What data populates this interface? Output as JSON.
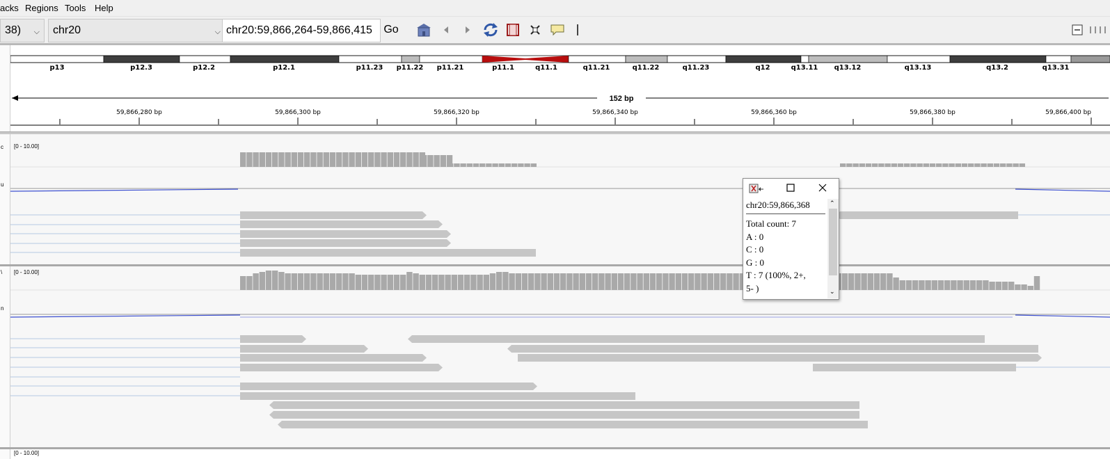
{
  "menu": [
    "acks",
    "Regions",
    "Tools",
    "Help"
  ],
  "toolbar": {
    "genome_value": "38)",
    "chromosome_value": "chr20",
    "locus_value": "chr20:59,866,264-59,866,415",
    "go_label": "Go"
  },
  "ideogram": {
    "bands": [
      "p13",
      "p12.3",
      "p12.2",
      "p12.1",
      "p11.23",
      "p11.22",
      "p11.21",
      "p11.1",
      "q11.1",
      "q11.21",
      "q11.22",
      "q11.23",
      "q12",
      "q13.11",
      "q13.12",
      "q13.13",
      "q13.2",
      "q13.31"
    ]
  },
  "ruler": {
    "span_label": "152 bp",
    "tick_labels": [
      "59,866,280 bp",
      "59,866,300 bp",
      "59,866,320 bp",
      "59,866,340 bp",
      "59,866,360 bp",
      "59,866,380 bp",
      "59,866,400 bp"
    ]
  },
  "tracks": {
    "coverage_range": "[0 - 10.00]"
  },
  "popup": {
    "lines": [
      "chr20:59,866,368",
      "Total count: 7",
      "A : 0",
      "C : 0",
      "G : 0",
      "T : 7 (100%, 2+,",
      "5- )"
    ]
  },
  "colors": {
    "centromere": "#b80d0d",
    "read": "#c6c6c6",
    "coverage": "#a9a9a9",
    "splice_line": "#9fb8dc",
    "connector_blue": "#3c4fd0"
  }
}
